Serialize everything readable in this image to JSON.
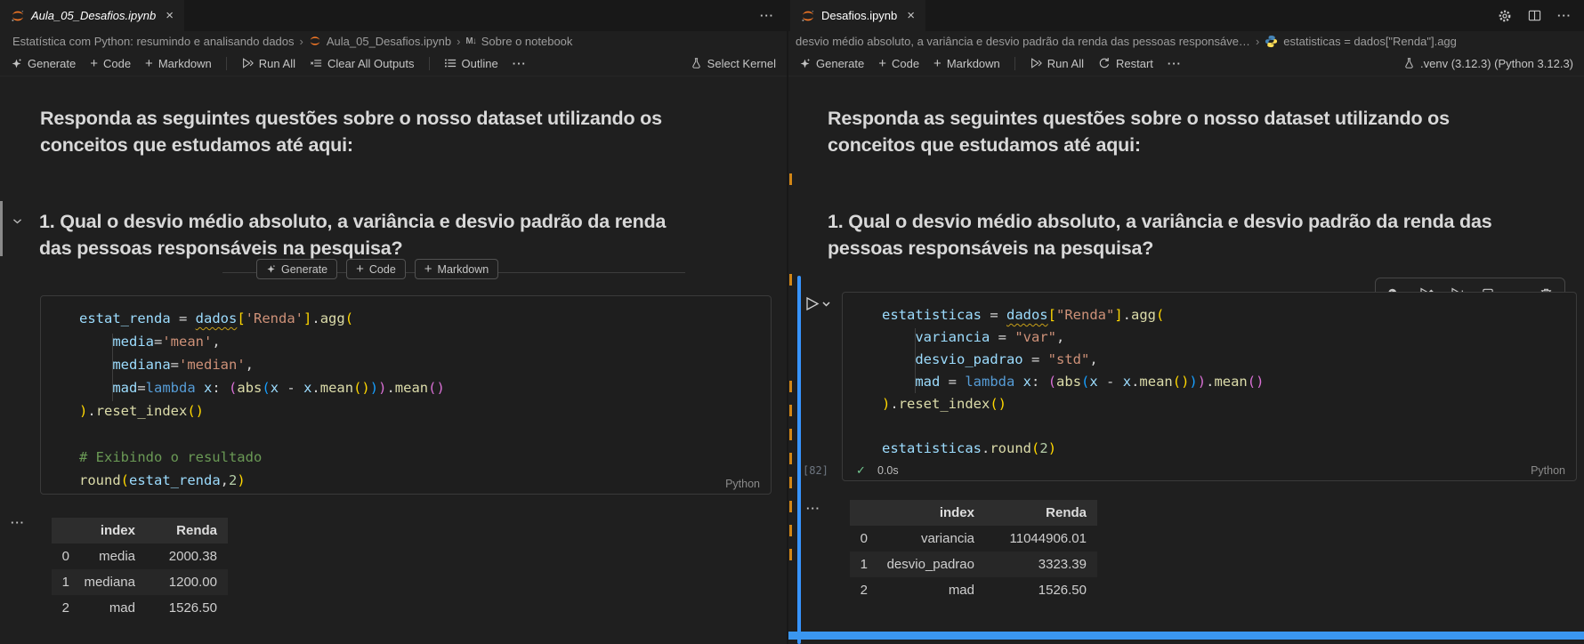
{
  "icons": {
    "close": "×",
    "more": "···",
    "plus": "+",
    "md_glyph": "M↓",
    "separator": "›"
  },
  "left": {
    "tab": "Aula_05_Desafios.ipynb",
    "breadcrumbs": {
      "a": "Estatística com Python: resumindo e analisando dados",
      "b": "Aula_05_Desafios.ipynb",
      "c": "Sobre o notebook"
    },
    "toolbar": {
      "generate": "Generate",
      "code": "Code",
      "markdown": "Markdown",
      "run_all": "Run All",
      "clear": "Clear All Outputs",
      "outline": "Outline",
      "kernel": "Select Kernel"
    },
    "md": {
      "h1": "Responda as seguintes questões sobre o nosso dataset utilizando os conceitos que estudamos até aqui:",
      "h2": "1. Qual o desvio médio absoluto, a variância e desvio padrão da renda das pessoas responsáveis na pesquisa?"
    },
    "hover": {
      "generate": "Generate",
      "code": "Code",
      "markdown": "Markdown"
    },
    "lang": "Python",
    "code": [
      [
        [
          "v",
          "estat_renda"
        ],
        [
          "o",
          " = "
        ],
        [
          "w",
          "dados"
        ],
        [
          "b1",
          "["
        ],
        [
          "s",
          "'Renda'"
        ],
        [
          "b1",
          "]"
        ],
        [
          "o",
          "."
        ],
        [
          "f",
          "agg"
        ],
        [
          "b1",
          "("
        ]
      ],
      [
        [
          "o",
          "    "
        ],
        [
          "v",
          "media"
        ],
        [
          "o",
          "="
        ],
        [
          "s",
          "'mean'"
        ],
        [
          "o",
          ","
        ]
      ],
      [
        [
          "o",
          "    "
        ],
        [
          "v",
          "mediana"
        ],
        [
          "o",
          "="
        ],
        [
          "s",
          "'median'"
        ],
        [
          "o",
          ","
        ]
      ],
      [
        [
          "o",
          "    "
        ],
        [
          "v",
          "mad"
        ],
        [
          "o",
          "="
        ],
        [
          "k",
          "lambda"
        ],
        [
          "o",
          " "
        ],
        [
          "v",
          "x"
        ],
        [
          "o",
          ": "
        ],
        [
          "b2",
          "("
        ],
        [
          "f",
          "abs"
        ],
        [
          "b3",
          "("
        ],
        [
          "v",
          "x"
        ],
        [
          "o",
          " - "
        ],
        [
          "v",
          "x"
        ],
        [
          "o",
          "."
        ],
        [
          "f",
          "mean"
        ],
        [
          "b1",
          "()"
        ],
        [
          "b3",
          ")"
        ],
        [
          "b2",
          ")"
        ],
        [
          "o",
          "."
        ],
        [
          "f",
          "mean"
        ],
        [
          "b2",
          "()"
        ]
      ],
      [
        [
          "b1",
          ")"
        ],
        [
          "o",
          "."
        ],
        [
          "f",
          "reset_index"
        ],
        [
          "b1",
          "()"
        ]
      ],
      [],
      [
        [
          "c",
          "# Exibindo o resultado"
        ]
      ],
      [
        [
          "f",
          "round"
        ],
        [
          "b1",
          "("
        ],
        [
          "v",
          "estat_renda"
        ],
        [
          "o",
          ","
        ],
        [
          "n",
          "2"
        ],
        [
          "b1",
          ")"
        ]
      ]
    ],
    "table": {
      "headers": [
        "index",
        "Renda"
      ],
      "rows": [
        [
          "0",
          "media",
          "2000.38"
        ],
        [
          "1",
          "mediana",
          "1200.00"
        ],
        [
          "2",
          "mad",
          "1526.50"
        ]
      ]
    }
  },
  "right": {
    "tab": "Desafios.ipynb",
    "breadcrumbs": {
      "a": "desvio médio absoluto, a variância e desvio padrão da renda das pessoas responsáve…",
      "b": "estatisticas = dados[\"Renda\"].agg"
    },
    "toolbar": {
      "generate": "Generate",
      "code": "Code",
      "markdown": "Markdown",
      "run_all": "Run All",
      "restart": "Restart",
      "kernel": ".venv (3.12.3) (Python 3.12.3)"
    },
    "md": {
      "h1": "Responda as seguintes questões sobre o nosso dataset utilizando os conceitos que estudamos até aqui:",
      "h2": "1. Qual o desvio médio absoluto, a variância e desvio padrão da renda das pessoas responsáveis na pesquisa?"
    },
    "lang": "Python",
    "exec": {
      "count": "[82]",
      "check": "✓",
      "time": "0.0s"
    },
    "code": [
      [
        [
          "v",
          "estatisticas"
        ],
        [
          "o",
          " = "
        ],
        [
          "w",
          "dados"
        ],
        [
          "b1",
          "["
        ],
        [
          "s",
          "\"Renda\""
        ],
        [
          "b1",
          "]"
        ],
        [
          "o",
          "."
        ],
        [
          "f",
          "agg"
        ],
        [
          "b1",
          "("
        ]
      ],
      [
        [
          "o",
          "    "
        ],
        [
          "v",
          "variancia"
        ],
        [
          "o",
          " = "
        ],
        [
          "s",
          "\"var\""
        ],
        [
          "o",
          ","
        ]
      ],
      [
        [
          "o",
          "    "
        ],
        [
          "v",
          "desvio_padrao"
        ],
        [
          "o",
          " = "
        ],
        [
          "s",
          "\"std\""
        ],
        [
          "o",
          ","
        ]
      ],
      [
        [
          "o",
          "    "
        ],
        [
          "v",
          "mad"
        ],
        [
          "o",
          " = "
        ],
        [
          "k",
          "lambda"
        ],
        [
          "o",
          " "
        ],
        [
          "v",
          "x"
        ],
        [
          "o",
          ": "
        ],
        [
          "b2",
          "("
        ],
        [
          "f",
          "abs"
        ],
        [
          "b3",
          "("
        ],
        [
          "v",
          "x"
        ],
        [
          "o",
          " - "
        ],
        [
          "v",
          "x"
        ],
        [
          "o",
          "."
        ],
        [
          "f",
          "mean"
        ],
        [
          "b1",
          "()"
        ],
        [
          "b3",
          ")"
        ],
        [
          "b2",
          ")"
        ],
        [
          "o",
          "."
        ],
        [
          "f",
          "mean"
        ],
        [
          "b2",
          "()"
        ]
      ],
      [
        [
          "b1",
          ")"
        ],
        [
          "o",
          "."
        ],
        [
          "f",
          "reset_index"
        ],
        [
          "b1",
          "()"
        ]
      ],
      [],
      [
        [
          "v",
          "estatisticas"
        ],
        [
          "o",
          "."
        ],
        [
          "f",
          "round"
        ],
        [
          "b1",
          "("
        ],
        [
          "n",
          "2"
        ],
        [
          "b1",
          ")"
        ]
      ]
    ],
    "table": {
      "headers": [
        "index",
        "Renda"
      ],
      "rows": [
        [
          "0",
          "variancia",
          "11044906.01"
        ],
        [
          "1",
          "desvio_padrao",
          "3323.39"
        ],
        [
          "2",
          "mad",
          "1526.50"
        ]
      ]
    }
  }
}
